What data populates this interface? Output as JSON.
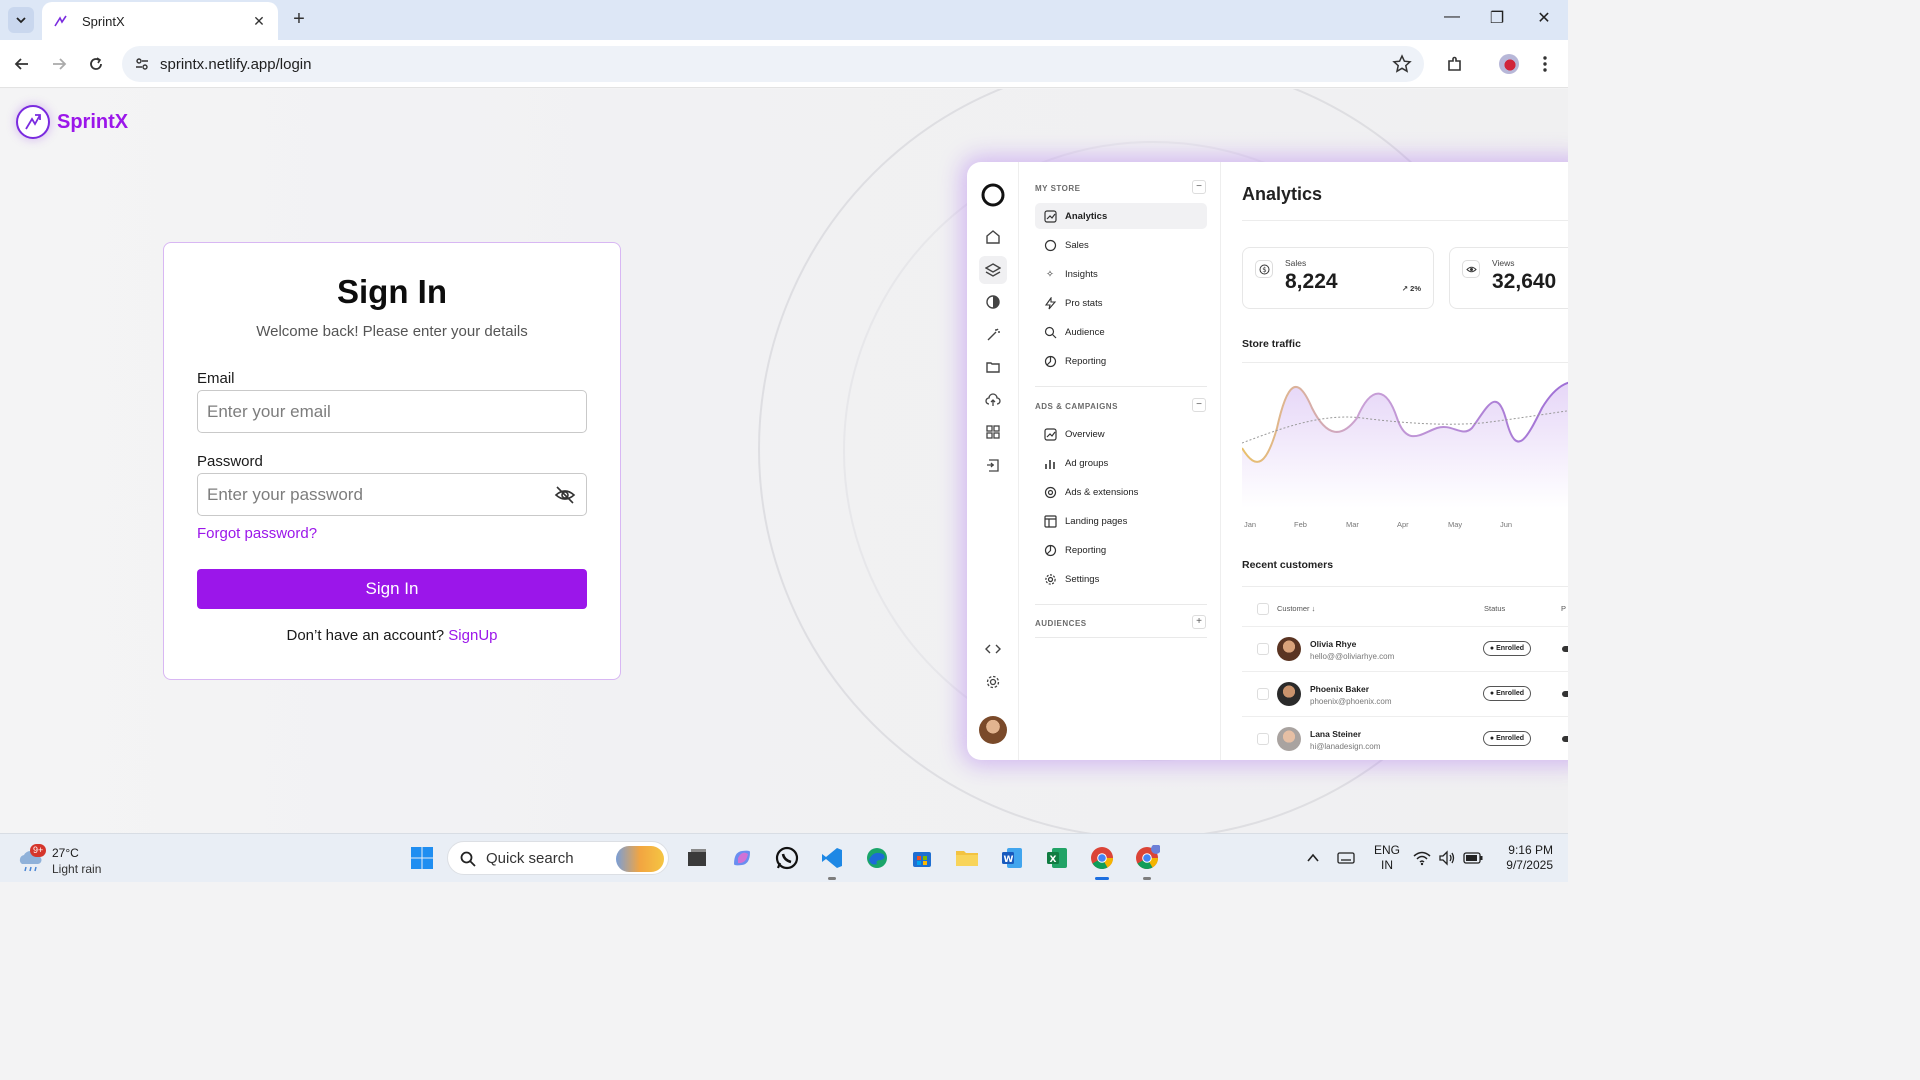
{
  "browser": {
    "tab_title": "SprintX",
    "url": "sprintx.netlify.app/login"
  },
  "brand": {
    "name": "SprintX",
    "accent": "#9b16ea"
  },
  "signin": {
    "heading": "Sign In",
    "subtitle": "Welcome back! Please enter your details",
    "email_label": "Email",
    "email_placeholder": "Enter your email",
    "password_label": "Password",
    "password_placeholder": "Enter your password",
    "forgot": "Forgot password?",
    "submit": "Sign In",
    "no_account": "Don’t have an account?",
    "signup": "SignUp"
  },
  "dashboard": {
    "section_store": "MY STORE",
    "store_items": [
      "Analytics",
      "Sales",
      "Insights",
      "Pro stats",
      "Audience",
      "Reporting"
    ],
    "section_ads": "ADS & CAMPAIGNS",
    "ads_items": [
      "Overview",
      "Ad groups",
      "Ads & extensions",
      "Landing pages",
      "Reporting",
      "Settings"
    ],
    "section_audiences": "AUDIENCES",
    "title": "Analytics",
    "stats": [
      {
        "label": "Sales",
        "value": "8,224",
        "delta": "↗ 2%"
      },
      {
        "label": "Views",
        "value": "32,640"
      }
    ],
    "traffic_title": "Store traffic",
    "months": [
      "Jan",
      "Feb",
      "Mar",
      "Apr",
      "May",
      "Jun"
    ],
    "customers_title": "Recent customers",
    "col_customer": "Customer ↓",
    "col_status": "Status",
    "col_extra": "P",
    "customers": [
      {
        "name": "Olivia Rhye",
        "email": "hello@@oliviarhye.com",
        "status": "● Enrolled"
      },
      {
        "name": "Phoenix Baker",
        "email": "phoenix@phoenix.com",
        "status": "● Enrolled"
      },
      {
        "name": "Lana Steiner",
        "email": "hi@lanadesign.com",
        "status": "● Enrolled"
      }
    ]
  },
  "taskbar": {
    "weather_temp": "27°C",
    "weather_desc": "Light rain",
    "weather_badge": "9+",
    "search": "Quick search",
    "lang1": "ENG",
    "lang2": "IN",
    "time": "9:16 PM",
    "date": "9/7/2025"
  }
}
